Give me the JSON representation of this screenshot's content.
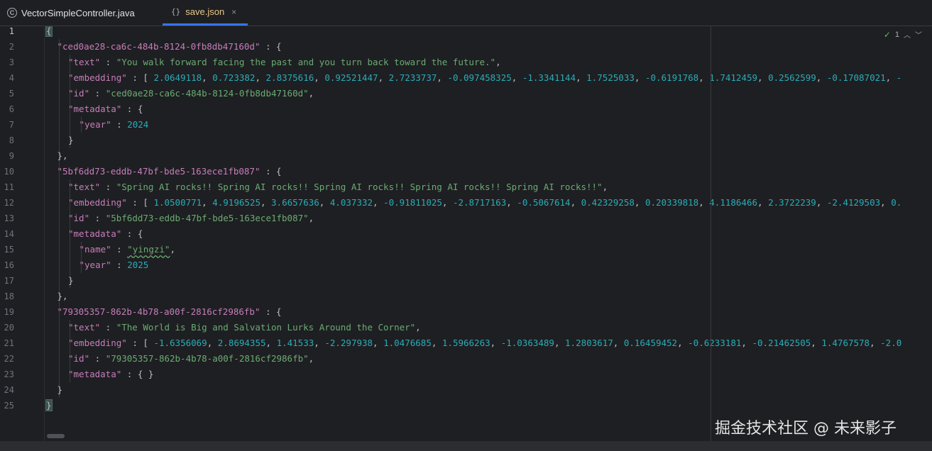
{
  "tabs": [
    {
      "label": "VectorSimpleController.java",
      "icon": "java-class-icon",
      "active": false
    },
    {
      "label": "save.json",
      "icon": "json-braces-icon",
      "active": true
    }
  ],
  "close_glyph": "×",
  "class_glyph": "C",
  "json_glyph": "{}",
  "inspections": {
    "count": "1"
  },
  "watermark": "掘金技术社区 @ 未来影子",
  "colors": {
    "key": "#c77dbb",
    "string": "#6aab73",
    "number": "#2aacb8",
    "accent": "#3574f0"
  },
  "editor_lines": [
    {
      "n": "1",
      "indent": 0,
      "tokens": [
        {
          "t": "{",
          "c": "punc"
        }
      ]
    },
    {
      "n": "2",
      "indent": 1,
      "tokens": [
        {
          "t": "\"ced0ae28-ca6c-484b-8124-0fb8db47160d\"",
          "c": "key"
        },
        {
          "t": " : {",
          "c": "punc"
        }
      ]
    },
    {
      "n": "3",
      "indent": 2,
      "tokens": [
        {
          "t": "\"text\"",
          "c": "key"
        },
        {
          "t": " : ",
          "c": "punc"
        },
        {
          "t": "\"You walk forward facing the past and you turn back toward the future.\"",
          "c": "str"
        },
        {
          "t": ",",
          "c": "punc"
        }
      ]
    },
    {
      "n": "4",
      "indent": 2,
      "tokens": [
        {
          "t": "\"embedding\"",
          "c": "key"
        },
        {
          "t": " : [ ",
          "c": "punc"
        },
        {
          "t": "2.0649118",
          "c": "num"
        },
        {
          "t": ", ",
          "c": "punc"
        },
        {
          "t": "0.723382",
          "c": "num"
        },
        {
          "t": ", ",
          "c": "punc"
        },
        {
          "t": "2.8375616",
          "c": "num"
        },
        {
          "t": ", ",
          "c": "punc"
        },
        {
          "t": "0.92521447",
          "c": "num"
        },
        {
          "t": ", ",
          "c": "punc"
        },
        {
          "t": "2.7233737",
          "c": "num"
        },
        {
          "t": ", ",
          "c": "punc"
        },
        {
          "t": "-0.097458325",
          "c": "num"
        },
        {
          "t": ", ",
          "c": "punc"
        },
        {
          "t": "-1.3341144",
          "c": "num"
        },
        {
          "t": ", ",
          "c": "punc"
        },
        {
          "t": "1.7525033",
          "c": "num"
        },
        {
          "t": ", ",
          "c": "punc"
        },
        {
          "t": "-0.6191768",
          "c": "num"
        },
        {
          "t": ", ",
          "c": "punc"
        },
        {
          "t": "1.7412459",
          "c": "num"
        },
        {
          "t": ", ",
          "c": "punc"
        },
        {
          "t": "0.2562599",
          "c": "num"
        },
        {
          "t": ", ",
          "c": "punc"
        },
        {
          "t": "-0.17087021",
          "c": "num"
        },
        {
          "t": ", ",
          "c": "punc"
        },
        {
          "t": "-",
          "c": "num"
        }
      ]
    },
    {
      "n": "5",
      "indent": 2,
      "tokens": [
        {
          "t": "\"id\"",
          "c": "key"
        },
        {
          "t": " : ",
          "c": "punc"
        },
        {
          "t": "\"ced0ae28-ca6c-484b-8124-0fb8db47160d\"",
          "c": "str"
        },
        {
          "t": ",",
          "c": "punc"
        }
      ]
    },
    {
      "n": "6",
      "indent": 2,
      "tokens": [
        {
          "t": "\"metadata\"",
          "c": "key"
        },
        {
          "t": " : {",
          "c": "punc"
        }
      ]
    },
    {
      "n": "7",
      "indent": 3,
      "tokens": [
        {
          "t": "\"year\"",
          "c": "key"
        },
        {
          "t": " : ",
          "c": "punc"
        },
        {
          "t": "2024",
          "c": "num"
        }
      ]
    },
    {
      "n": "8",
      "indent": 2,
      "tokens": [
        {
          "t": "}",
          "c": "punc"
        }
      ]
    },
    {
      "n": "9",
      "indent": 1,
      "tokens": [
        {
          "t": "},",
          "c": "punc"
        }
      ]
    },
    {
      "n": "10",
      "indent": 1,
      "tokens": [
        {
          "t": "\"5bf6dd73-eddb-47bf-bde5-163ece1fb087\"",
          "c": "key"
        },
        {
          "t": " : {",
          "c": "punc"
        }
      ]
    },
    {
      "n": "11",
      "indent": 2,
      "tokens": [
        {
          "t": "\"text\"",
          "c": "key"
        },
        {
          "t": " : ",
          "c": "punc"
        },
        {
          "t": "\"Spring AI rocks!! Spring AI rocks!! Spring AI rocks!! Spring AI rocks!! Spring AI rocks!!\"",
          "c": "str"
        },
        {
          "t": ",",
          "c": "punc"
        }
      ]
    },
    {
      "n": "12",
      "indent": 2,
      "tokens": [
        {
          "t": "\"embedding\"",
          "c": "key"
        },
        {
          "t": " : [ ",
          "c": "punc"
        },
        {
          "t": "1.0500771",
          "c": "num"
        },
        {
          "t": ", ",
          "c": "punc"
        },
        {
          "t": "4.9196525",
          "c": "num"
        },
        {
          "t": ", ",
          "c": "punc"
        },
        {
          "t": "3.6657636",
          "c": "num"
        },
        {
          "t": ", ",
          "c": "punc"
        },
        {
          "t": "4.037332",
          "c": "num"
        },
        {
          "t": ", ",
          "c": "punc"
        },
        {
          "t": "-0.91811025",
          "c": "num"
        },
        {
          "t": ", ",
          "c": "punc"
        },
        {
          "t": "-2.8717163",
          "c": "num"
        },
        {
          "t": ", ",
          "c": "punc"
        },
        {
          "t": "-0.5067614",
          "c": "num"
        },
        {
          "t": ", ",
          "c": "punc"
        },
        {
          "t": "0.42329258",
          "c": "num"
        },
        {
          "t": ", ",
          "c": "punc"
        },
        {
          "t": "0.20339818",
          "c": "num"
        },
        {
          "t": ", ",
          "c": "punc"
        },
        {
          "t": "4.1186466",
          "c": "num"
        },
        {
          "t": ", ",
          "c": "punc"
        },
        {
          "t": "2.3722239",
          "c": "num"
        },
        {
          "t": ", ",
          "c": "punc"
        },
        {
          "t": "-2.4129503",
          "c": "num"
        },
        {
          "t": ", ",
          "c": "punc"
        },
        {
          "t": "0.",
          "c": "num"
        }
      ]
    },
    {
      "n": "13",
      "indent": 2,
      "tokens": [
        {
          "t": "\"id\"",
          "c": "key"
        },
        {
          "t": " : ",
          "c": "punc"
        },
        {
          "t": "\"5bf6dd73-eddb-47bf-bde5-163ece1fb087\"",
          "c": "str"
        },
        {
          "t": ",",
          "c": "punc"
        }
      ]
    },
    {
      "n": "14",
      "indent": 2,
      "tokens": [
        {
          "t": "\"metadata\"",
          "c": "key"
        },
        {
          "t": " : {",
          "c": "punc"
        }
      ]
    },
    {
      "n": "15",
      "indent": 3,
      "tokens": [
        {
          "t": "\"name\"",
          "c": "key"
        },
        {
          "t": " : ",
          "c": "punc"
        },
        {
          "t": "\"yingzi\"",
          "c": "str wavy"
        },
        {
          "t": ",",
          "c": "punc"
        }
      ]
    },
    {
      "n": "16",
      "indent": 3,
      "tokens": [
        {
          "t": "\"year\"",
          "c": "key"
        },
        {
          "t": " : ",
          "c": "punc"
        },
        {
          "t": "2025",
          "c": "num"
        }
      ]
    },
    {
      "n": "17",
      "indent": 2,
      "tokens": [
        {
          "t": "}",
          "c": "punc"
        }
      ]
    },
    {
      "n": "18",
      "indent": 1,
      "tokens": [
        {
          "t": "},",
          "c": "punc"
        }
      ]
    },
    {
      "n": "19",
      "indent": 1,
      "tokens": [
        {
          "t": "\"79305357-862b-4b78-a00f-2816cf2986fb\"",
          "c": "key"
        },
        {
          "t": " : {",
          "c": "punc"
        }
      ]
    },
    {
      "n": "20",
      "indent": 2,
      "tokens": [
        {
          "t": "\"text\"",
          "c": "key"
        },
        {
          "t": " : ",
          "c": "punc"
        },
        {
          "t": "\"The World is Big and Salvation Lurks Around the Corner\"",
          "c": "str"
        },
        {
          "t": ",",
          "c": "punc"
        }
      ]
    },
    {
      "n": "21",
      "indent": 2,
      "tokens": [
        {
          "t": "\"embedding\"",
          "c": "key"
        },
        {
          "t": " : [ ",
          "c": "punc"
        },
        {
          "t": "-1.6356069",
          "c": "num"
        },
        {
          "t": ", ",
          "c": "punc"
        },
        {
          "t": "2.8694355",
          "c": "num"
        },
        {
          "t": ", ",
          "c": "punc"
        },
        {
          "t": "1.41533",
          "c": "num"
        },
        {
          "t": ", ",
          "c": "punc"
        },
        {
          "t": "-2.297938",
          "c": "num"
        },
        {
          "t": ", ",
          "c": "punc"
        },
        {
          "t": "1.0476685",
          "c": "num"
        },
        {
          "t": ", ",
          "c": "punc"
        },
        {
          "t": "1.5966263",
          "c": "num"
        },
        {
          "t": ", ",
          "c": "punc"
        },
        {
          "t": "-1.0363489",
          "c": "num"
        },
        {
          "t": ", ",
          "c": "punc"
        },
        {
          "t": "1.2803617",
          "c": "num"
        },
        {
          "t": ", ",
          "c": "punc"
        },
        {
          "t": "0.16459452",
          "c": "num"
        },
        {
          "t": ", ",
          "c": "punc"
        },
        {
          "t": "-0.6233181",
          "c": "num"
        },
        {
          "t": ", ",
          "c": "punc"
        },
        {
          "t": "-0.21462505",
          "c": "num"
        },
        {
          "t": ", ",
          "c": "punc"
        },
        {
          "t": "1.4767578",
          "c": "num"
        },
        {
          "t": ", ",
          "c": "punc"
        },
        {
          "t": "-2.0",
          "c": "num"
        }
      ]
    },
    {
      "n": "22",
      "indent": 2,
      "tokens": [
        {
          "t": "\"id\"",
          "c": "key"
        },
        {
          "t": " : ",
          "c": "punc"
        },
        {
          "t": "\"79305357-862b-4b78-a00f-2816cf2986fb\"",
          "c": "str"
        },
        {
          "t": ",",
          "c": "punc"
        }
      ]
    },
    {
      "n": "23",
      "indent": 2,
      "tokens": [
        {
          "t": "\"metadata\"",
          "c": "key"
        },
        {
          "t": " : { }",
          "c": "punc"
        }
      ]
    },
    {
      "n": "24",
      "indent": 1,
      "tokens": [
        {
          "t": "}",
          "c": "punc"
        }
      ]
    },
    {
      "n": "25",
      "indent": 0,
      "tokens": [
        {
          "t": "}",
          "c": "punc"
        }
      ]
    }
  ]
}
